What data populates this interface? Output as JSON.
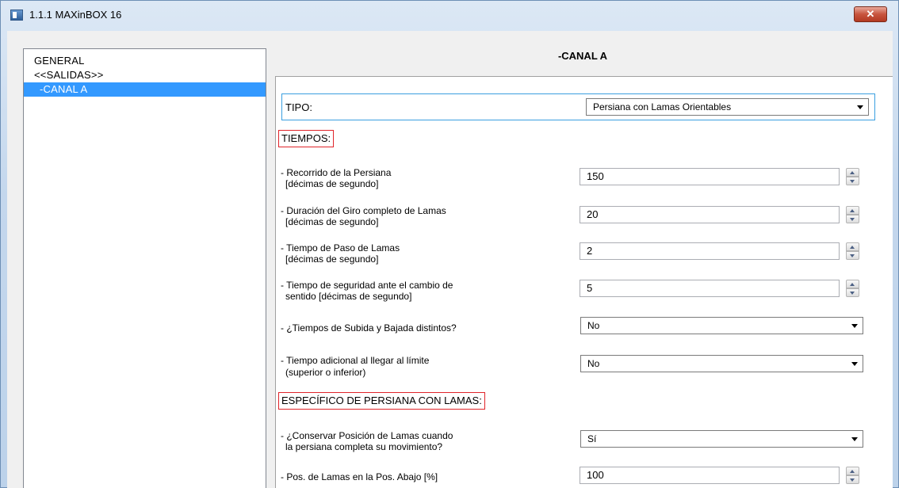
{
  "window": {
    "title": "1.1.1 MAXinBOX 16",
    "close_label": "✕"
  },
  "tree": {
    "items": [
      {
        "label": "GENERAL"
      },
      {
        "label": "<<SALIDAS>>"
      },
      {
        "label": "-CANAL A",
        "selected": true
      }
    ]
  },
  "panel": {
    "title": "-CANAL A"
  },
  "tipo": {
    "label": "TIPO:",
    "value": "Persiana con Lamas Orientables"
  },
  "tiempos": {
    "heading": "TIEMPOS:",
    "recorrido": {
      "label_1": "- Recorrido de la Persiana",
      "label_2": "[décimas de segundo]",
      "value": "150"
    },
    "giro": {
      "label_1": "- Duración del Giro completo de Lamas",
      "label_2": "[décimas de segundo]",
      "value": "20"
    },
    "paso": {
      "label_1": "- Tiempo de Paso de Lamas",
      "label_2": "[décimas de segundo]",
      "value": "2"
    },
    "seguridad": {
      "label_1": "- Tiempo de seguridad ante el cambio de",
      "label_2": "sentido [décimas de segundo]",
      "value": "5"
    },
    "subida_bajada": {
      "label": "- ¿Tiempos de Subida y Bajada distintos?",
      "value": "No"
    },
    "adicional": {
      "label_1": "- Tiempo adicional al llegar al límite",
      "label_2": "(superior o inferior)",
      "value": "No"
    }
  },
  "especifico": {
    "heading": "ESPECÍFICO DE PERSIANA CON LAMAS:",
    "conservar": {
      "label_1": "- ¿Conservar Posición de Lamas cuando",
      "label_2": "la persiana completa su movimiento?",
      "value": "Sí"
    },
    "pos_abajo": {
      "label": "- Pos. de Lamas en la Pos. Abajo [%]",
      "value": "100"
    }
  },
  "colors": {
    "selection": "#3399ff",
    "section_border": "#e0242a",
    "focus_border": "#3a9fe0"
  }
}
